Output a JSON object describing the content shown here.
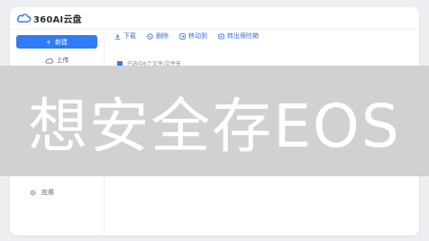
{
  "app": {
    "logo_text": "360AI云盘"
  },
  "sidebar": {
    "new_label": "新建",
    "upload_label": "上传",
    "apps_label": "应用"
  },
  "toolbar": {
    "download": "下载",
    "delete": "删除",
    "move": "移动到",
    "transfer": "转出保险箱"
  },
  "selection": {
    "status_text": "已选中6个文件/文件夹"
  },
  "overlay": {
    "text": "想安全存EOS"
  },
  "colors": {
    "accent": "#2f7cf6",
    "overlay": "#d0d0d0",
    "background": "#eeeff2"
  }
}
